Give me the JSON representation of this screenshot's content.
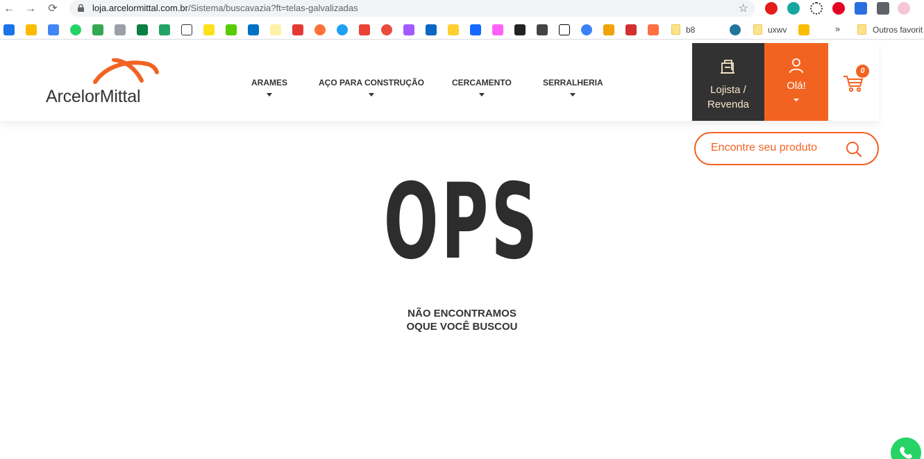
{
  "browser": {
    "url_domain": "loja.arcelormittal.com.br",
    "url_path": "/Sistema/buscavazia?ft=telas-galvalizadas",
    "bookmarks_text": {
      "b8": "b8",
      "uxwv": "uxwv",
      "more": "»",
      "others": "Outros favorit"
    }
  },
  "header": {
    "logo_text": "ArcelorMittal",
    "menu": [
      "ARAMES",
      "AÇO PARA CONSTRUÇÃO",
      "CERCAMENTO",
      "SERRALHERIA"
    ],
    "lojista_label_line1": "Lojista /",
    "lojista_label_line2": "Revenda",
    "ola_label": "Olá!",
    "cart_count": "0"
  },
  "search": {
    "placeholder": "Encontre seu produto"
  },
  "main": {
    "title": "OPS",
    "message_line1": "NÃO ENCONTRAMOS",
    "message_line2": "OQUE VOCÊ BUSCOU"
  },
  "colors": {
    "brand_orange": "#f26322",
    "dark": "#333232"
  }
}
